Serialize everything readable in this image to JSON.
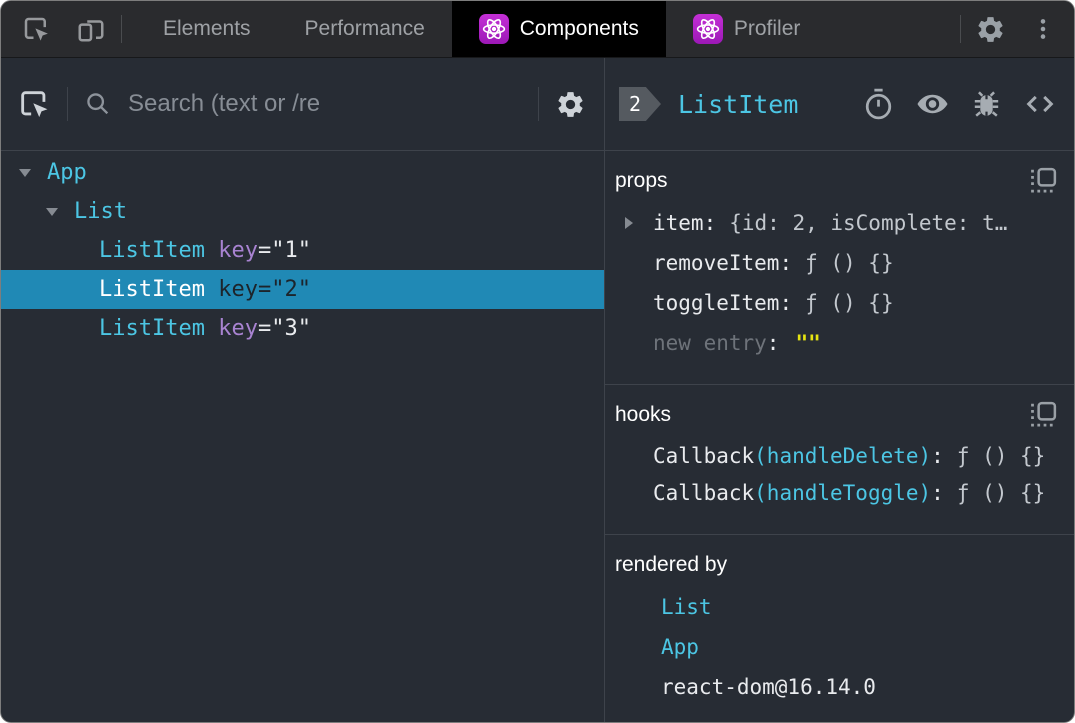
{
  "colors": {
    "accent_cyan": "#4cc6e4",
    "selected_row_bg": "#2089b5",
    "attr_purple": "#a883d1",
    "string_yellow": "#e5e412",
    "react_logo_purple": "#b224c9",
    "panel_bg": "#272c34",
    "chrome_bg": "#2a2b2e",
    "active_tab_bg": "#000000"
  },
  "icons": {
    "topbar": [
      "inspect-element",
      "toggle-device-toolbar",
      "react-logo",
      "settings-gear",
      "more-options-dots"
    ],
    "left_toolbar": [
      "inspect-element",
      "search-magnifier",
      "settings-gear"
    ],
    "right_header": [
      "suspend-stopwatch",
      "inspect-dom-eye",
      "log-to-console-bug",
      "view-source-brackets"
    ],
    "section": [
      "copy-to-clipboard"
    ]
  },
  "topbar": {
    "tabs": [
      {
        "label": "Elements",
        "active": false
      },
      {
        "label": "Performance",
        "active": false
      },
      {
        "label": "Components",
        "active": true
      },
      {
        "label": "Profiler",
        "active": false
      }
    ]
  },
  "left_panel": {
    "search": {
      "placeholder": "Search (text or /re"
    },
    "tree": [
      {
        "name": "App",
        "depth": 0,
        "expanded": true
      },
      {
        "name": "List",
        "depth": 1,
        "expanded": true
      },
      {
        "name": "ListItem",
        "depth": 2,
        "attr": "key",
        "eqval": "=\"1\""
      },
      {
        "name": "ListItem",
        "depth": 2,
        "attr": "key",
        "eqval": "=\"2\"",
        "selected": true
      },
      {
        "name": "ListItem",
        "depth": 2,
        "attr": "key",
        "eqval": "=\"3\""
      }
    ]
  },
  "right_panel": {
    "owner_badge": "2",
    "selected_component": "ListItem",
    "props": {
      "title": "props",
      "rows": [
        {
          "key": "item",
          "sep": ":",
          "value": "{id: 2, isComplete: t…",
          "expandable": true
        },
        {
          "key": "removeItem",
          "sep": ":",
          "value": "ƒ () {}"
        },
        {
          "key": "toggleItem",
          "sep": ":",
          "value": "ƒ () {}"
        }
      ],
      "new_entry": {
        "label": "new entry",
        "sep": ":",
        "value": "\"\""
      }
    },
    "hooks": {
      "title": "hooks",
      "rows": [
        {
          "name": "Callback",
          "arg": "(handleDelete)",
          "sep": ":",
          "value": "ƒ () {}"
        },
        {
          "name": "Callback",
          "arg": "(handleToggle)",
          "sep": ":",
          "value": "ƒ () {}"
        }
      ]
    },
    "rendered_by": {
      "title": "rendered by",
      "items": [
        {
          "label": "List"
        },
        {
          "label": "App"
        },
        {
          "label": "react-dom@16.14.0"
        }
      ]
    }
  }
}
